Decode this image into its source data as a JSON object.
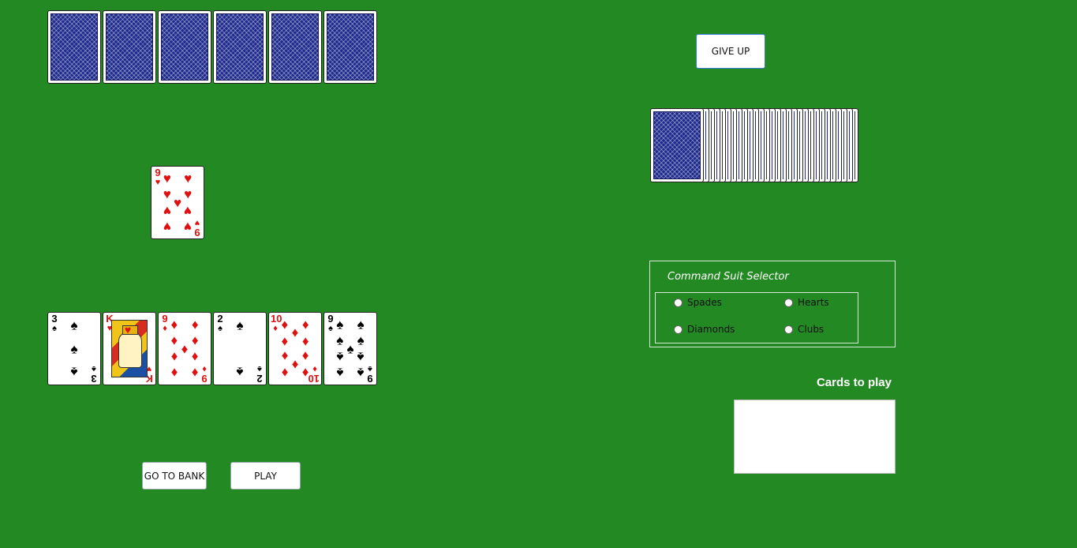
{
  "table": {
    "background": "#238923",
    "card_back_color": "#1d2a8c"
  },
  "opponent_hand": {
    "count": 6
  },
  "draw_pile": {
    "visible_cards": 29
  },
  "discard_top": {
    "rank": "9",
    "suit": "hearts",
    "suit_symbol": "♥",
    "color": "red"
  },
  "player_hand": [
    {
      "rank": "3",
      "suit": "spades",
      "suit_symbol": "♠",
      "color": "black"
    },
    {
      "rank": "K",
      "suit": "hearts",
      "suit_symbol": "♥",
      "color": "red"
    },
    {
      "rank": "9",
      "suit": "diamonds",
      "suit_symbol": "♦",
      "color": "red"
    },
    {
      "rank": "2",
      "suit": "spades",
      "suit_symbol": "♠",
      "color": "black"
    },
    {
      "rank": "10",
      "suit": "diamonds",
      "suit_symbol": "♦",
      "color": "red"
    },
    {
      "rank": "9",
      "suit": "spades",
      "suit_symbol": "♠",
      "color": "black"
    }
  ],
  "buttons": {
    "give_up": "GIVE UP",
    "go_to_bank": "GO TO BANK",
    "play": "PLAY"
  },
  "suit_selector": {
    "legend": "Command Suit Selector",
    "options": [
      "Spades",
      "Hearts",
      "Diamonds",
      "Clubs"
    ]
  },
  "cards_to_play": {
    "label": "Cards to play"
  }
}
